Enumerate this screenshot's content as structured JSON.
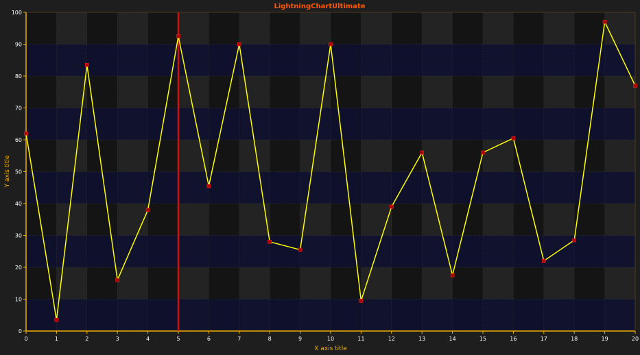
{
  "chart_data": {
    "type": "line",
    "title": "LightningChartUltimate",
    "xlabel": "X axis title",
    "ylabel": "Y axis title",
    "xlim": [
      0,
      20
    ],
    "ylim": [
      0,
      100
    ],
    "x_ticks": [
      0,
      1,
      2,
      3,
      4,
      5,
      6,
      7,
      8,
      9,
      10,
      11,
      12,
      13,
      14,
      15,
      16,
      17,
      18,
      19,
      20
    ],
    "y_ticks": [
      0,
      10,
      20,
      30,
      40,
      50,
      60,
      70,
      80,
      90,
      100
    ],
    "grid": true,
    "series": [
      {
        "x": [
          0,
          1,
          2,
          3,
          4,
          5,
          6,
          7,
          8,
          9,
          10,
          11,
          12,
          13,
          14,
          15,
          16,
          17,
          18,
          19,
          20
        ],
        "values": [
          62,
          3.5,
          83.5,
          16,
          38,
          92.5,
          45.5,
          90,
          28,
          25.5,
          90,
          9.5,
          39,
          56,
          17.5,
          56,
          60.5,
          22,
          28.5,
          97,
          77
        ]
      }
    ],
    "cursor": {
      "x": 5
    },
    "colors": {
      "background": "#1e1e1e",
      "band_dark": "#141414",
      "band_light": "#232323",
      "band_blue": "#0d0f30",
      "line": "#ffff00",
      "marker": "#aa0000",
      "cursor": "#cc1111",
      "axis": "#f0b000",
      "title": "#ff5500"
    }
  }
}
